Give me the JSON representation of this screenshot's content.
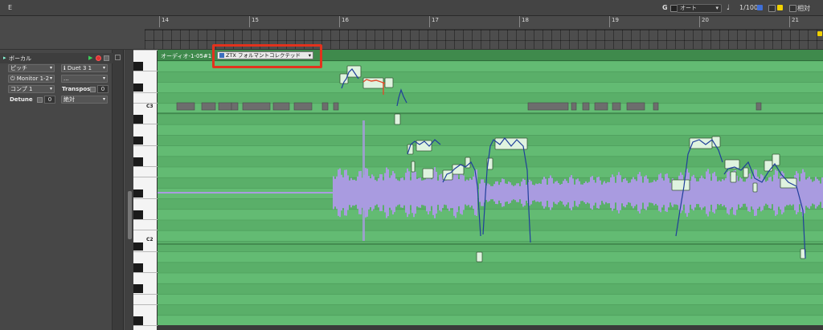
{
  "topbar": {
    "title": "E",
    "grid_label": "G",
    "mode_value": "オート",
    "quantize_value": "1/1000",
    "relative_label": "相対"
  },
  "ruler": {
    "bars": [
      "14",
      "15",
      "16",
      "17",
      "18",
      "19",
      "20",
      "21"
    ]
  },
  "inspector": {
    "track_name": "ボーカル",
    "pitch_label": "ピッチ",
    "preset_value": "Duet 3 1",
    "monitor_value": "Monitor 1-2",
    "dash_value": "...",
    "comp_label": "コンプ 1",
    "transpose_label": "Transpose",
    "transpose_value": "0",
    "detune_label": "Detune",
    "detune_value": "0",
    "absolute_label": "絶対"
  },
  "piano": {
    "c3": "C3",
    "c2": "C2"
  },
  "region": {
    "name": "オーディオ-1-05#1",
    "algorithm": "ZTX フォルマントコレクテッド"
  },
  "colors": {
    "highlight": "#e2321d",
    "grid_green": "#5fb66f",
    "waveform": "#a99be0",
    "pitch_curve": "#1f3f9a",
    "note_block": "#dff3df",
    "edited_curve": "#e04a2a"
  }
}
